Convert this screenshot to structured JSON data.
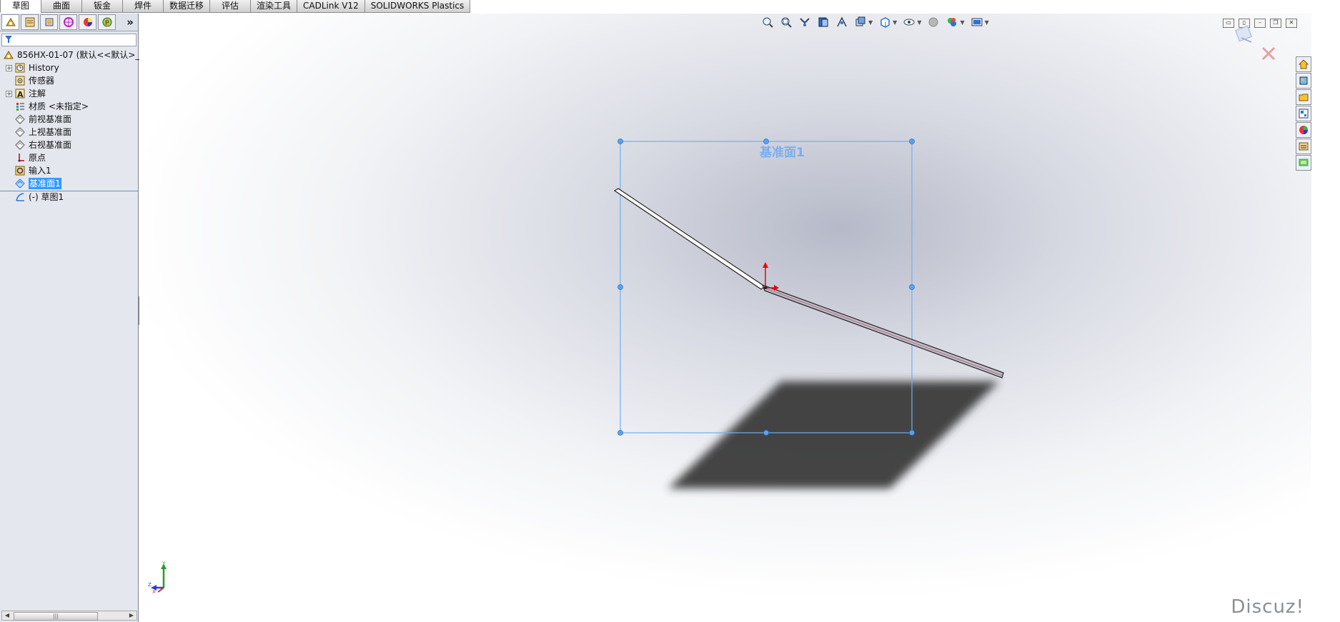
{
  "tabs": [
    {
      "label": "草图",
      "active": true
    },
    {
      "label": "曲面",
      "active": false
    },
    {
      "label": "钣金",
      "active": false
    },
    {
      "label": "焊件",
      "active": false
    },
    {
      "label": "数据迁移",
      "active": false
    },
    {
      "label": "评估",
      "active": false
    },
    {
      "label": "渲染工具",
      "active": false
    },
    {
      "label": "CADLink V12",
      "active": false
    },
    {
      "label": "SOLIDWORKS Plastics",
      "active": false
    }
  ],
  "manager": {
    "tab_icons": [
      "featuremanager-icon",
      "propertymanager-icon",
      "configurationmanager-icon",
      "dimxpert-icon",
      "display-manager-icon",
      "photoview-icon"
    ],
    "more_label": "»",
    "tree": {
      "root": "856HX-01-07  (默认<<默认>_",
      "items": [
        {
          "label": "History",
          "icon": "history-icon",
          "expandable": true
        },
        {
          "label": "传感器",
          "icon": "sensor-icon",
          "expandable": false
        },
        {
          "label": "注解",
          "icon": "annotation-icon",
          "expandable": true
        },
        {
          "label": "材质 <未指定>",
          "icon": "material-icon",
          "expandable": false
        },
        {
          "label": "前视基准面",
          "icon": "plane-icon",
          "expandable": false
        },
        {
          "label": "上视基准面",
          "icon": "plane-icon",
          "expandable": false
        },
        {
          "label": "右视基准面",
          "icon": "plane-icon",
          "expandable": false
        },
        {
          "label": "原点",
          "icon": "origin-icon",
          "expandable": false
        },
        {
          "label": "输入1",
          "icon": "imported-body-icon",
          "expandable": false
        },
        {
          "label": "基准面1",
          "icon": "plane-selected-icon",
          "expandable": false,
          "selected": true
        },
        {
          "label": "(-) 草图1",
          "icon": "sketch-icon",
          "expandable": false
        }
      ]
    }
  },
  "viewport": {
    "plane_label": "基准面1",
    "watermark": "Discuz!",
    "triad": {
      "y": "Y",
      "x": "X",
      "z": "Z"
    },
    "heads_up_icons": [
      "zoom-to-fit-icon",
      "zoom-to-area-icon",
      "previous-view-icon",
      "section-view-icon",
      "dynamic-annotation-icon",
      "view-orientation-icon",
      "display-style-icon",
      "hide-show-items-icon",
      "edit-appearance-icon",
      "apply-scene-icon",
      "view-settings-icon"
    ],
    "task_pane_icons": [
      "home-icon",
      "design-library-icon",
      "file-explorer-icon",
      "view-palette-icon",
      "appearances-icon",
      "custom-properties-icon",
      "solidworks-forum-icon"
    ]
  }
}
